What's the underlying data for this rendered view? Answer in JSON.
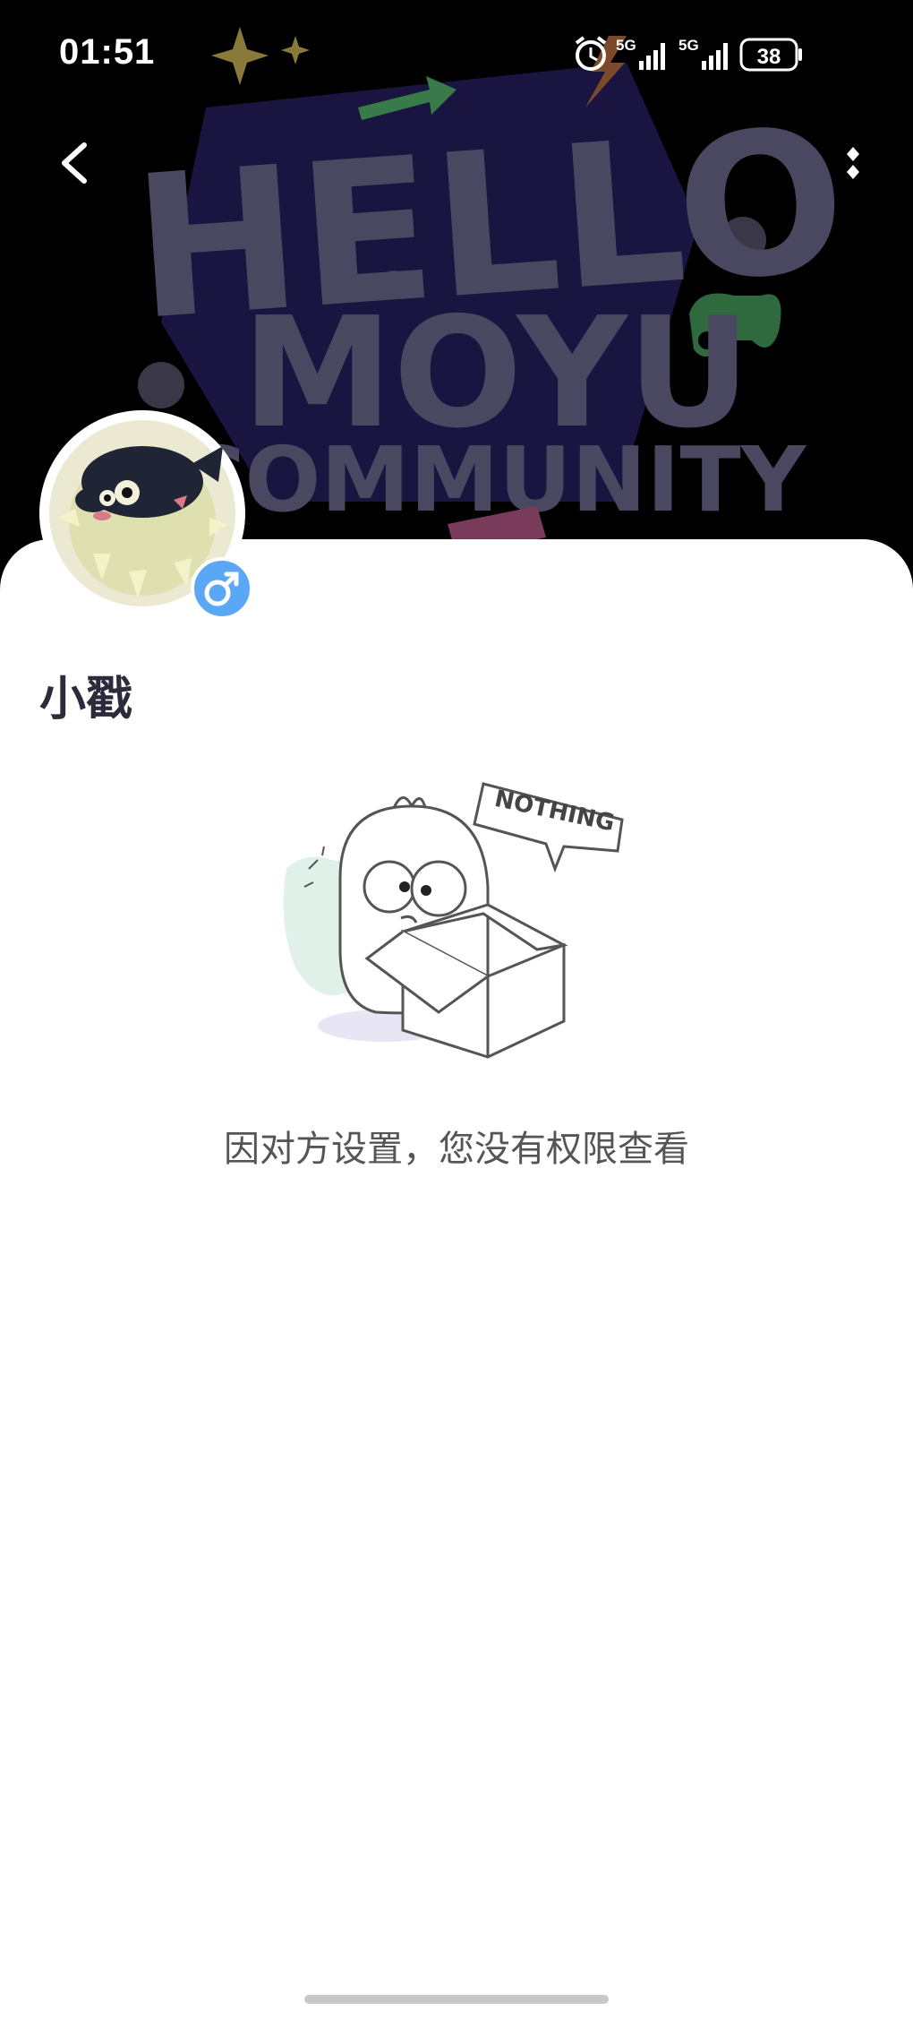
{
  "status_bar": {
    "time": "01:51",
    "network_1": "5G",
    "network_2": "5G",
    "battery_level": "38",
    "icons": [
      "lightning-icon",
      "alarm-icon",
      "signal-5g-icon",
      "signal-5g-icon",
      "battery-icon"
    ]
  },
  "nav": {
    "back_icon": "chevron-left-icon",
    "more_icon": "more-vertical-icon"
  },
  "banner": {
    "line1": "HELLO",
    "line2": "MOYU",
    "line3": "COMMUNITY"
  },
  "profile": {
    "username": "小戳",
    "gender_icon": "male-icon"
  },
  "empty_state": {
    "illustration_label": "NOTHING",
    "message": "因对方设置，您没有权限查看"
  },
  "colors": {
    "banner_background": "#000000",
    "banner_text": "#4a4860",
    "gender_badge": "#5aa8f5",
    "username": "#2b2b3c"
  }
}
